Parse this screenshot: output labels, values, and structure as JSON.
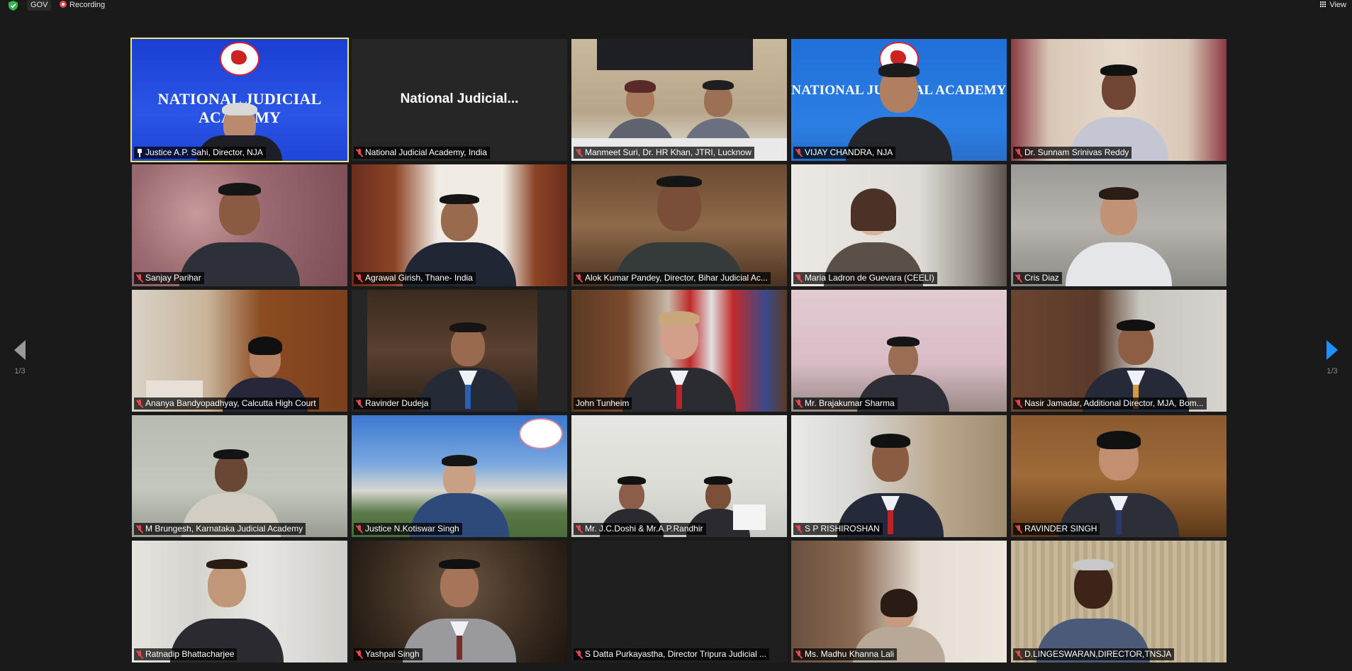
{
  "topbar": {
    "badge": "GOV",
    "recording_label": "Recording",
    "view_label": "View"
  },
  "pagination": {
    "left_indicator": "1/3",
    "right_indicator": "1/3"
  },
  "tiles": [
    {
      "name": "Justice A.P. Sahi, Director, NJA",
      "active": true,
      "pinned": true
    },
    {
      "name": "National Judicial Academy, India",
      "display_name": "National  Judicial..."
    },
    {
      "name": "Manmeet Suri, Dr. HR Khan, JTRI, Lucknow"
    },
    {
      "name": "VIJAY CHANDRA, NJA"
    },
    {
      "name": "Dr. Sunnam Srinivas Reddy"
    },
    {
      "name": "Sanjay Parihar"
    },
    {
      "name": "Agrawal Girish, Thane- India"
    },
    {
      "name": "Alok Kumar Pandey, Director, Bihar Judicial Ac..."
    },
    {
      "name": "Maria Ladron de Guevara (CEELI)"
    },
    {
      "name": "Cris Diaz"
    },
    {
      "name": "Ananya Bandyopadhyay, Calcutta High Court"
    },
    {
      "name": "Ravinder Dudeja"
    },
    {
      "name": "John Tunheim",
      "mic_on": true
    },
    {
      "name": "Mr. Brajakumar Sharma"
    },
    {
      "name": "Nasir Jamadar, Additional Director, MJA, Bom..."
    },
    {
      "name": "M Brungesh, Karnataka Judicial Academy"
    },
    {
      "name": "Justice N.Kotiswar Singh"
    },
    {
      "name": "Mr. J.C.Doshi & Mr.A.P.Randhir"
    },
    {
      "name": "S P RISHIROSHAN"
    },
    {
      "name": "RAVINDER SINGH"
    },
    {
      "name": "Ratnadip Bhattacharjee"
    },
    {
      "name": "Yashpal Singh"
    },
    {
      "name": "S Datta Purkayastha, Director Tripura Judicial ..."
    },
    {
      "name": "Ms. Madhu Khanna Lali"
    },
    {
      "name": "D.LINGESWARAN,DIRECTOR,TNSJA"
    }
  ],
  "banner": {
    "text": "NATIONAL JUDICIAL ACADEMY"
  },
  "colors": {
    "active_speaker_border": "#f2e66b",
    "mic_muted": "#e5484d",
    "next_arrow": "#1e90ff",
    "recording": "#e5484d"
  }
}
